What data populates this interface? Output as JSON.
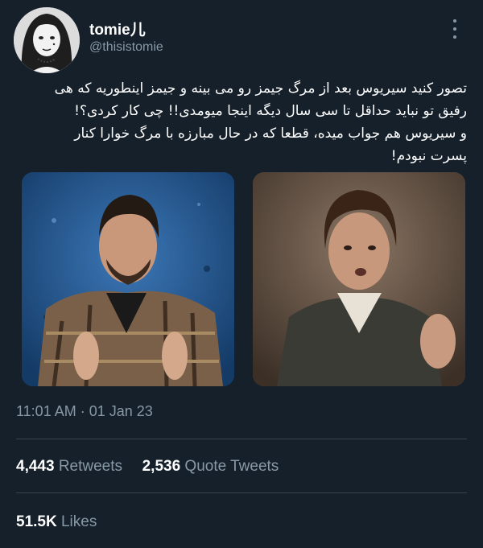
{
  "author": {
    "display_name": "tomie",
    "name_glyph": "⼉",
    "handle": "@thisistomie"
  },
  "more_icon": "more-vertical-icon",
  "tweet": {
    "lines": [
      "تصور کنید سیریوس بعد از مرگ جیمز رو می بینه و جیمز اینطوریه که هی",
      "رفیق تو نباید حداقل تا سی سال دیگه اینجا میومدی!! چی کار کردی؟!",
      "و سیریوس هم جواب میده، قطعا که در حال مبارزه با مرگ خوارا کنار",
      "پسرت نبودم!"
    ]
  },
  "timestamp": {
    "time": "11:01 AM",
    "separator": "·",
    "date": "01 Jan 23"
  },
  "stats": {
    "retweets_count": "4,443",
    "retweets_label": "Retweets",
    "quotes_count": "2,536",
    "quotes_label": "Quote Tweets",
    "likes_count": "51.5K",
    "likes_label": "Likes"
  },
  "colors": {
    "background": "#15202b",
    "secondary_text": "#8899a6",
    "divider": "#38444d"
  }
}
